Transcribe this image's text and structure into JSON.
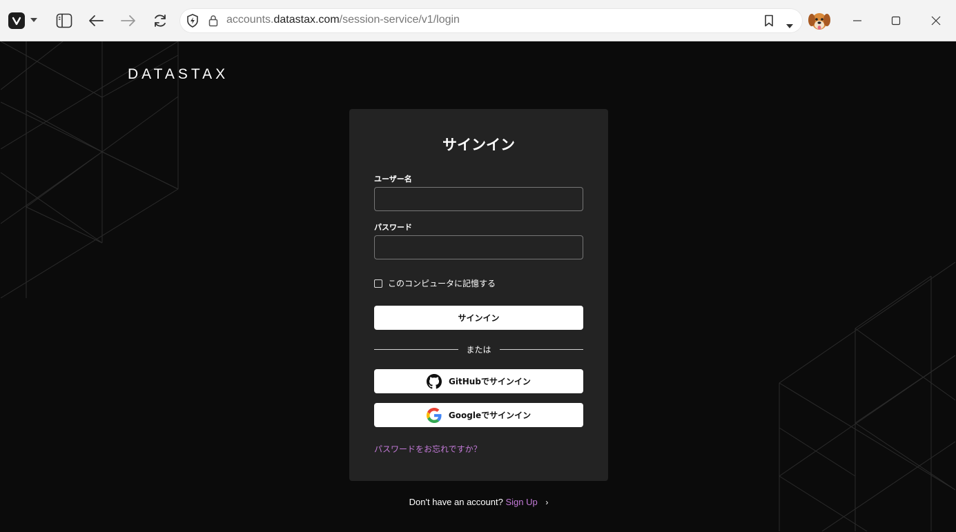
{
  "browser": {
    "url_prefix": "accounts.",
    "url_host": "datastax.com",
    "url_path": "/session-service/v1/login"
  },
  "page": {
    "logo_text": "DATASTAX",
    "card": {
      "title": "サインイン",
      "username_label": "ユーザー名",
      "password_label": "パスワード",
      "username_value": "",
      "password_value": "",
      "remember_label": "このコンピュータに記憶する",
      "remember_checked": false,
      "signin_button": "サインイン",
      "divider_text": "または",
      "github_button": "GitHubでサインイン",
      "google_button": "Googleでサインイン",
      "forgot_link": "パスワードをお忘れですか？"
    },
    "signup": {
      "prompt": "Don't have an account?",
      "link": "Sign Up",
      "chevron": "›"
    }
  },
  "colors": {
    "page_bg": "#0b0b0b",
    "card_bg": "#232323",
    "link": "#c37ad8",
    "button_bg": "#ffffff"
  },
  "icons": [
    "vivaldi-logo-icon",
    "sidebar-toggle-icon",
    "back-arrow-icon",
    "forward-arrow-icon",
    "reload-icon",
    "shield-icon",
    "lock-icon",
    "bookmark-icon",
    "dropdown-caret-icon",
    "profile-avatar",
    "minimize-icon",
    "maximize-icon",
    "close-icon",
    "github-icon",
    "google-icon"
  ]
}
